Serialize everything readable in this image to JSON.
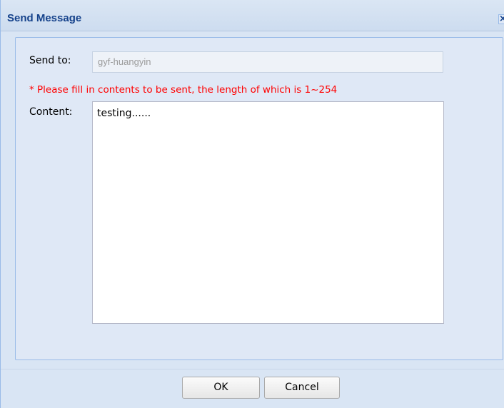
{
  "dialog": {
    "title": "Send Message",
    "close_glyph": "✕",
    "close_icon": "close-icon"
  },
  "form": {
    "send_to_label": "Send to:",
    "send_to_value": "gyf-huangyin",
    "hint": "* Please fill in contents to be sent, the length of which is 1~254",
    "content_label": "Content:",
    "content_value": "testing......"
  },
  "buttons": {
    "ok_label": "OK",
    "cancel_label": "Cancel"
  },
  "colors": {
    "title": "#15428b",
    "hint": "#ff0000"
  }
}
